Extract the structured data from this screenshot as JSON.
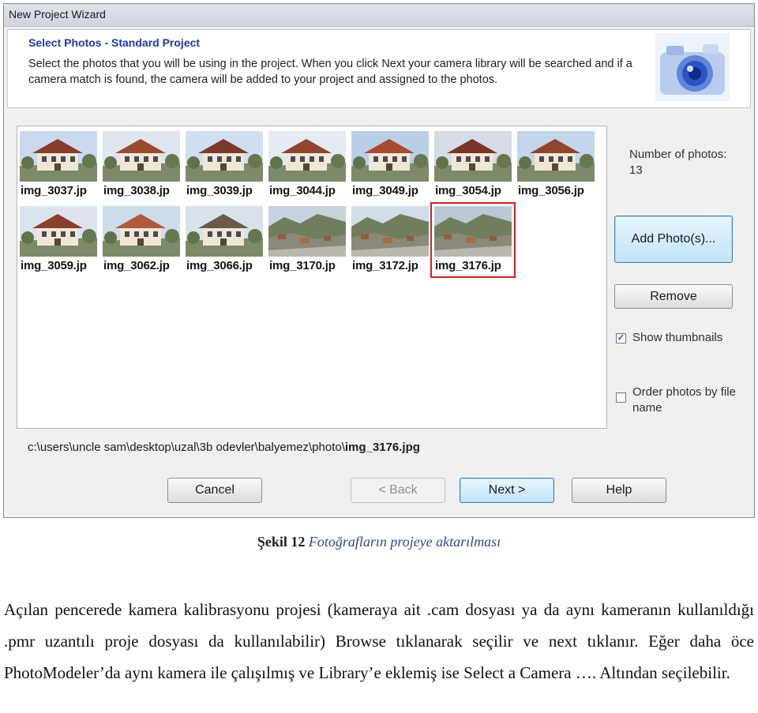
{
  "window": {
    "title": "New Project Wizard",
    "step_title": "Select Photos - Standard Project",
    "step_description": "Select the photos that you will be using in the project. When you click Next your camera library will be searched and if a camera match is found, the camera will be added to your project and assigned to the photos.",
    "header_icon": "camera-icon"
  },
  "thumbnails": [
    {
      "label": "img_3037.jp",
      "selected": false
    },
    {
      "label": "img_3038.jp",
      "selected": false
    },
    {
      "label": "img_3039.jp",
      "selected": false
    },
    {
      "label": "img_3044.jp",
      "selected": false
    },
    {
      "label": "img_3049.jp",
      "selected": false
    },
    {
      "label": "img_3054.jp",
      "selected": false
    },
    {
      "label": "img_3056.jp",
      "selected": false
    },
    {
      "label": "img_3059.jp",
      "selected": false
    },
    {
      "label": "img_3062.jp",
      "selected": false
    },
    {
      "label": "img_3066.jp",
      "selected": false
    },
    {
      "label": "img_3170.jp",
      "selected": false
    },
    {
      "label": "img_3172.jp",
      "selected": false
    },
    {
      "label": "img_3176.jp",
      "selected": true
    }
  ],
  "side_panel": {
    "count_label": "Number of photos: 13",
    "add_button": "Add Photo(s)...",
    "remove_button": "Remove",
    "show_thumbnails_label": "Show thumbnails",
    "show_thumbnails_checked": true,
    "order_by_name_label": "Order photos by file name",
    "order_by_name_checked": false
  },
  "path": {
    "dir": "c:\\users\\uncle sam\\desktop\\uzal\\3b odevler\\balyemez\\photo\\",
    "file": "img_3176.jpg"
  },
  "footer_buttons": {
    "cancel": "Cancel",
    "back": "< Back",
    "next": "Next >",
    "help": "Help"
  },
  "caption": {
    "number": "Şekil 12",
    "text": "Fotoğrafların projeye aktarılması"
  },
  "paragraph": "Açılan pencerede kamera kalibrasyonu projesi (kameraya ait .cam dosyası ya da aynı kameranın kullanıldığı .pmr uzantılı proje dosyası da kullanılabilir) Browse tıklanarak seçilir ve next tıklanır. Eğer daha öce PhotoModeler’da aynı kamera ile çalışılmış ve Library’e eklemiş ise Select a Camera …. Altından seçilebilir."
}
